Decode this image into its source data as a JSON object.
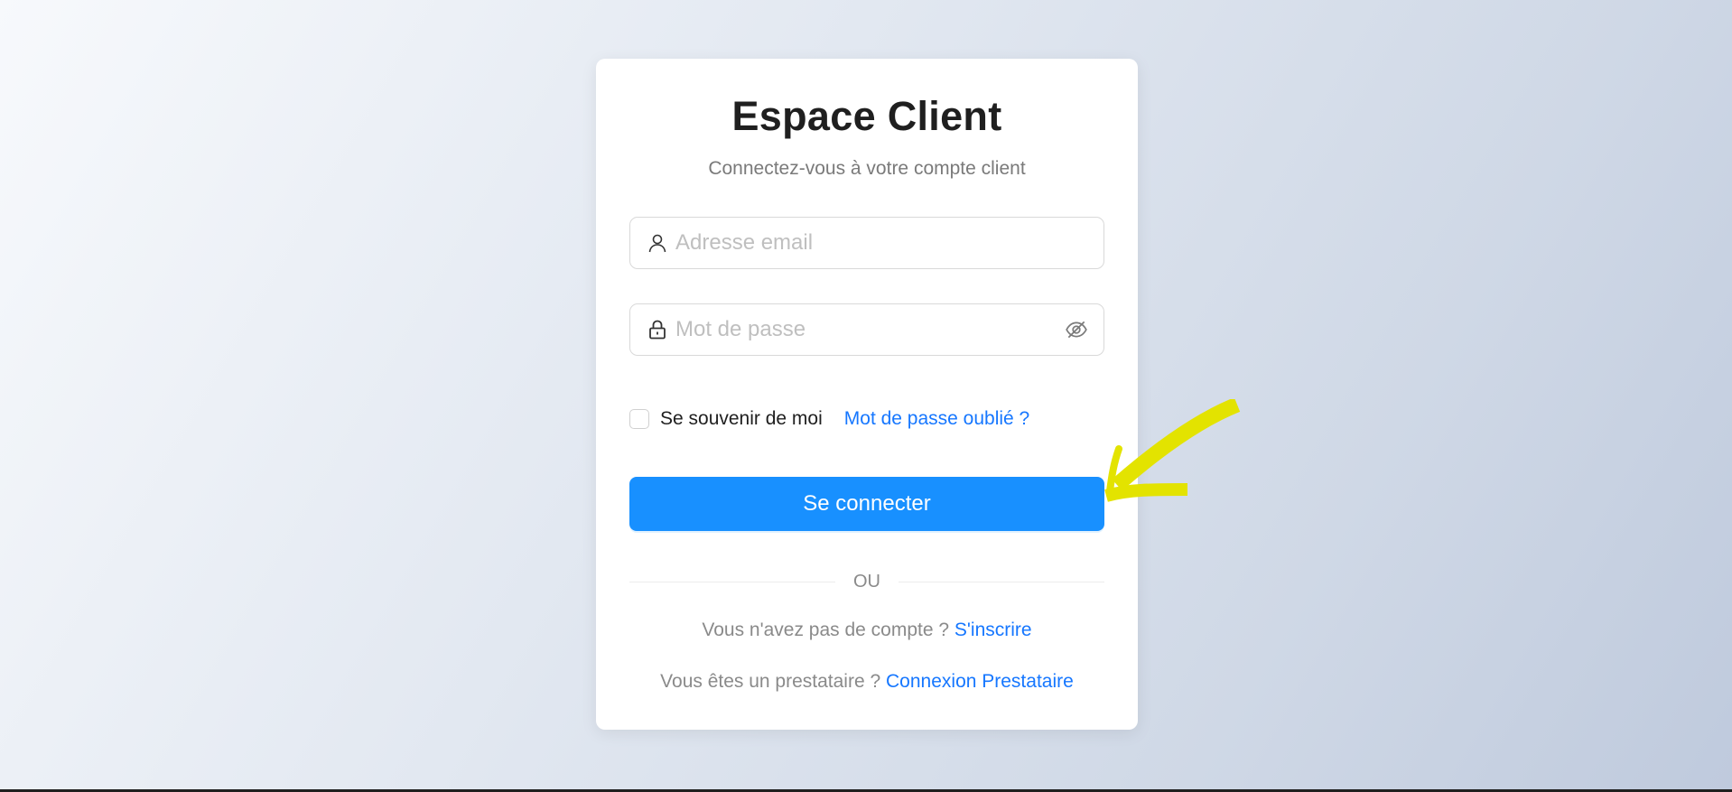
{
  "login": {
    "title": "Espace Client",
    "subtitle": "Connectez-vous à votre compte client",
    "email_placeholder": "Adresse email",
    "password_placeholder": "Mot de passe",
    "remember_label": "Se souvenir de moi",
    "forgot_label": "Mot de passe oublié ?",
    "submit_label": "Se connecter",
    "divider_text": "OU",
    "register_prompt": "Vous n'avez pas de compte ?",
    "register_link": "S'inscrire",
    "provider_prompt": "Vous êtes un prestataire ?",
    "provider_link": "Connexion Prestataire"
  },
  "colors": {
    "primary": "#1890ff",
    "link": "#1677ff",
    "annotation": "#e6e600"
  },
  "icons": {
    "email_field": "user-icon",
    "password_field": "lock-icon",
    "password_toggle": "eye-off-icon"
  }
}
